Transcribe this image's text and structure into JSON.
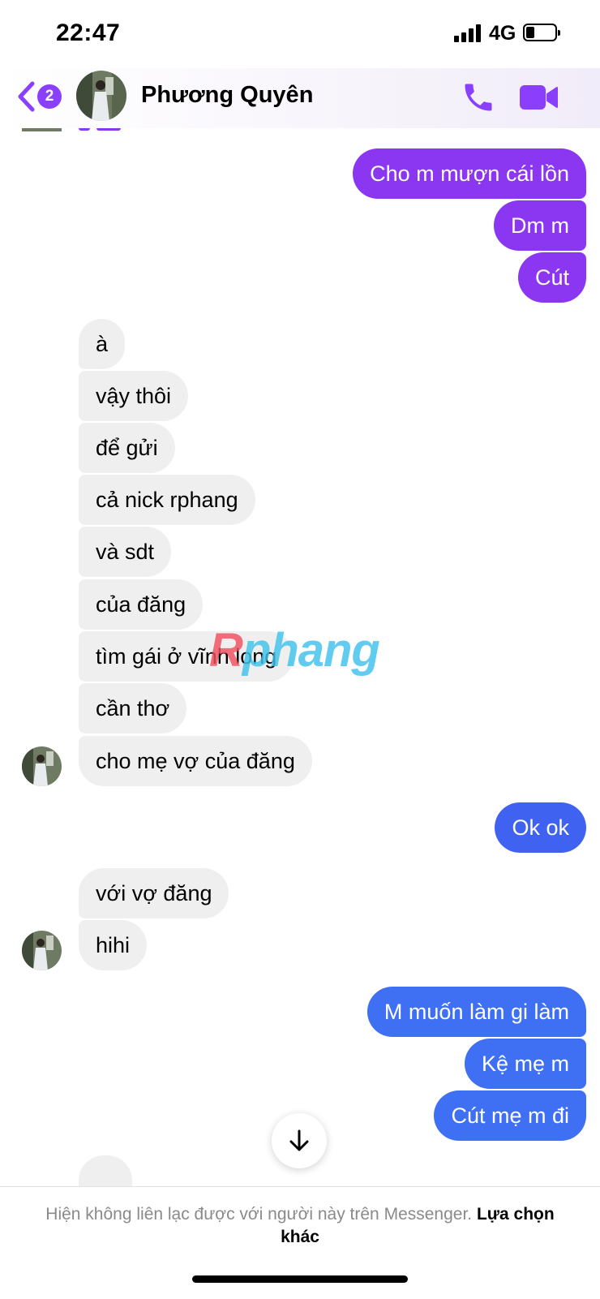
{
  "status_bar": {
    "time": "22:47",
    "network": "4G"
  },
  "header": {
    "unread_count": "2",
    "contact_name": "Phương Quyên"
  },
  "messages": [
    {
      "dir": "out",
      "text": "Cho m mượn cái lồn",
      "color": "#8b36f0"
    },
    {
      "dir": "out",
      "text": "Dm m",
      "color": "#8b36f0"
    },
    {
      "dir": "out",
      "text": "Cút",
      "color": "#8b36f0"
    },
    {
      "dir": "in",
      "text": "à"
    },
    {
      "dir": "in",
      "text": "vậy thôi"
    },
    {
      "dir": "in",
      "text": "để gửi"
    },
    {
      "dir": "in",
      "text": "cả nick rphang"
    },
    {
      "dir": "in",
      "text": "và sdt"
    },
    {
      "dir": "in",
      "text": "của đăng"
    },
    {
      "dir": "in",
      "text": "tìm gái ở vĩnh long"
    },
    {
      "dir": "in",
      "text": "cần thơ"
    },
    {
      "dir": "in",
      "text": "cho mẹ vợ của đăng"
    },
    {
      "dir": "out",
      "text": "Ok ok",
      "color": "#3f63f0"
    },
    {
      "dir": "in",
      "text": "với vợ đăng"
    },
    {
      "dir": "in",
      "text": "hihi"
    },
    {
      "dir": "out",
      "text": "M muốn làm gi làm",
      "color": "#3f6ff2"
    },
    {
      "dir": "out",
      "text": "Kệ mẹ m",
      "color": "#3f6ff2"
    },
    {
      "dir": "out",
      "text": "Cút mẹ m đi",
      "color": "#3f6ff2"
    }
  ],
  "watermark": {
    "first": "R",
    "rest": "phang"
  },
  "footer": {
    "notice": "Hiện không liên lạc được với người này trên Messenger.",
    "option_label": "Lựa chọn khác"
  },
  "colors": {
    "accent": "#8a3ffc",
    "outgoing_purple": "#8b36f0",
    "outgoing_blue": "#3f6ff2",
    "incoming_bg": "#efefef"
  }
}
